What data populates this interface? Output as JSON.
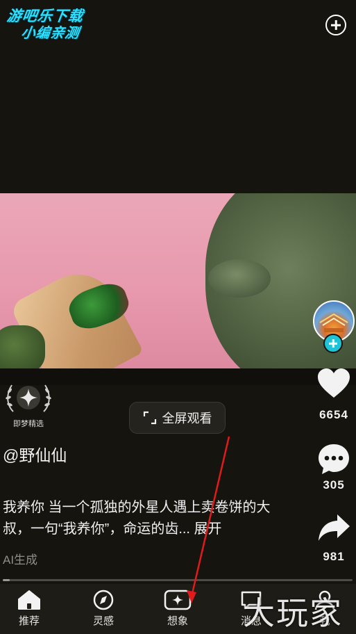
{
  "watermark": {
    "line1": "游吧乐下载",
    "line2": "小编亲测"
  },
  "top_bar": {
    "add_icon": "plus-circle-icon"
  },
  "video": {
    "scene": "alien-holding-wrap"
  },
  "badge": {
    "label": "即梦精选",
    "icon": "laurel-sparkle-icon"
  },
  "fullscreen": {
    "label": "全屏观看",
    "icon": "expand-icon"
  },
  "author": {
    "name": "@野仙仙"
  },
  "description": {
    "text": "我养你 当一个孤独的外星人遇上卖卷饼的大叔，一句“我养你”，命运的齿...",
    "expand_label": "展开"
  },
  "ai_tag": "AI生成",
  "progress": {
    "value": 0.02
  },
  "actions": {
    "likes": "6654",
    "comments": "305",
    "shares": "981"
  },
  "nav": {
    "items": [
      {
        "label": "推荐",
        "icon": "home-icon"
      },
      {
        "label": "灵感",
        "icon": "compass-icon"
      },
      {
        "label": "想象",
        "icon": "sparkle-create-icon"
      },
      {
        "label": "消息",
        "icon": "message-icon"
      },
      {
        "label": "我",
        "icon": "profile-icon"
      }
    ]
  },
  "bottom_watermark": "大玩家",
  "colors": {
    "accent": "#1fc3d6",
    "background": "#15140f",
    "annotation": "#e01b1b"
  }
}
